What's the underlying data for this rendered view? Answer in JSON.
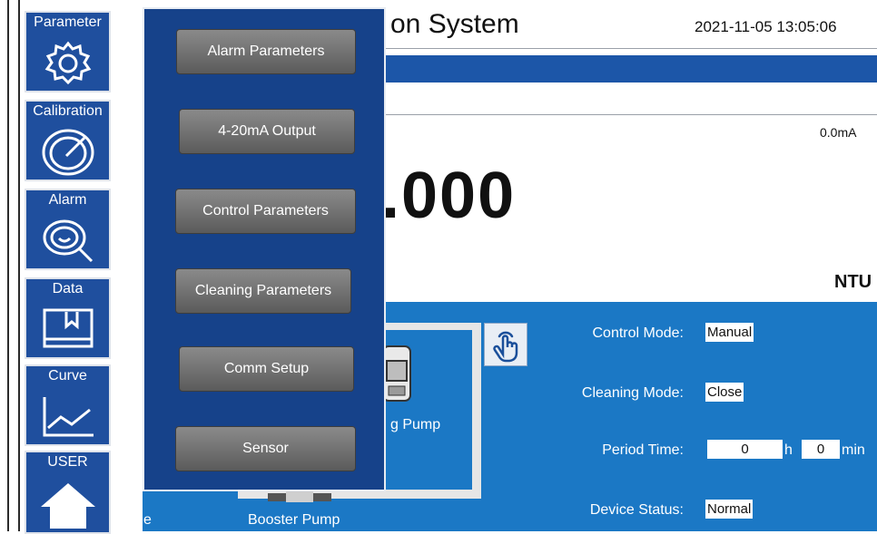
{
  "header": {
    "title": "on System",
    "datetime": "2021-11-05 13:05:06"
  },
  "nav": {
    "items": [
      {
        "label": "Parameter",
        "icon": "gear-icon"
      },
      {
        "label": "Calibration",
        "icon": "gauge-icon"
      },
      {
        "label": "Alarm",
        "icon": "alarm-magnifier-icon"
      },
      {
        "label": "Data",
        "icon": "data-book-icon"
      },
      {
        "label": "Curve",
        "icon": "trend-chart-icon"
      },
      {
        "label": "USER",
        "icon": "home-icon"
      }
    ]
  },
  "menu": {
    "items": [
      "Alarm Parameters",
      "4-20mA Output",
      "Control Parameters",
      "Cleaning Parameters",
      "Comm Setup",
      "Sensor"
    ]
  },
  "reading": {
    "current": "0.0mA",
    "value": ".000",
    "unit": "NTU"
  },
  "pumps": {
    "cleaning_label": "g Pump",
    "booster_label": "Booster Pump",
    "left_fragment": "e"
  },
  "controls": {
    "control_mode_label": "Control Mode:",
    "control_mode_value": "Manual",
    "cleaning_mode_label": "Cleaning Mode:",
    "cleaning_mode_value": "Close",
    "period_time_label": "Period Time:",
    "period_hours": "0",
    "hours_unit": "h",
    "period_minutes": "0",
    "minutes_unit": "min",
    "device_status_label": "Device Status:",
    "device_status_value": "Normal"
  },
  "colors": {
    "nav_blue": "#1f4f9e",
    "panel_blue": "#1b78c5",
    "menu_blue": "#16428a"
  }
}
